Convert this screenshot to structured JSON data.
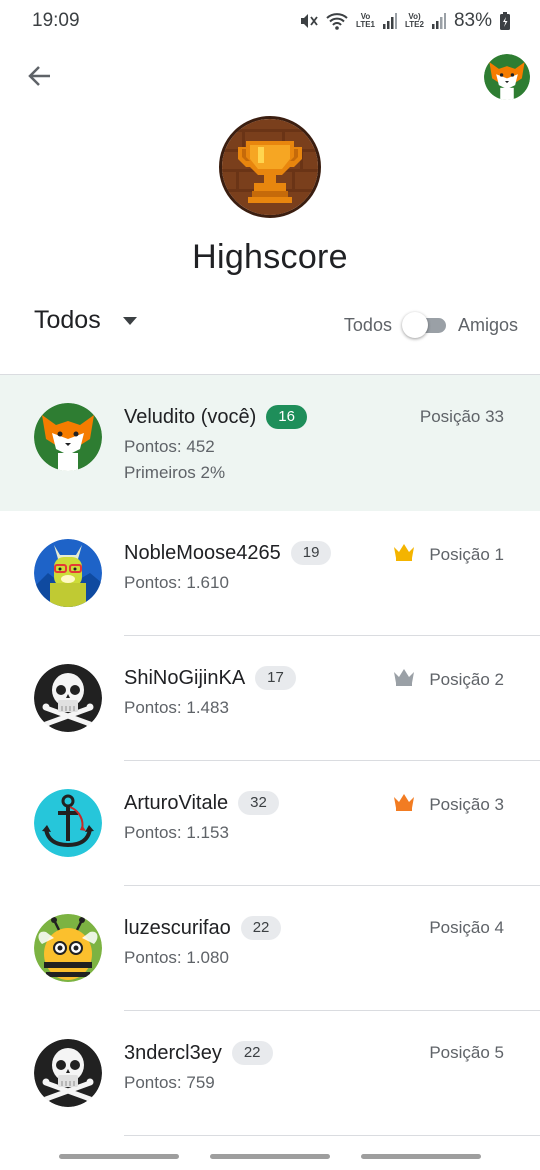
{
  "status_bar": {
    "time": "19:09",
    "battery": "83%",
    "icons": [
      "mute-icon",
      "wifi-icon",
      "volte-lte1-icon",
      "signal-1-icon",
      "volte-lte2-icon",
      "signal-2-icon",
      "battery-charging-icon"
    ],
    "lte1_top": "Vo",
    "lte1_bottom": "LTE1",
    "lte2_top": "Vo)",
    "lte2_bottom": "LTE2"
  },
  "header": {
    "title": "Highscore",
    "back_icon": "arrow-back-icon",
    "trophy_icon": "pixel-trophy-icon"
  },
  "filters": {
    "dropdown_value": "Todos",
    "toggle_left": "Todos",
    "toggle_right": "Amigos",
    "toggle_on": false
  },
  "leaderboard": [
    {
      "name": "Veludito (você)",
      "level": "16",
      "points": "Pontos: 452",
      "percentile": "Primeiros 2%",
      "rank": "Posição 33",
      "avatar": "fox-avatar",
      "crown": null,
      "is_me": true
    },
    {
      "name": "NobleMoose4265",
      "level": "19",
      "points": "Pontos: 1.610",
      "rank": "Posição 1",
      "avatar": "llama-avatar",
      "crown": "#f4b400"
    },
    {
      "name": "ShiNoGijinKA",
      "level": "17",
      "points": "Pontos: 1.483",
      "rank": "Posição 2",
      "avatar": "skull-avatar",
      "crown": "#9aa0a6"
    },
    {
      "name": "ArturoVitale",
      "level": "32",
      "points": "Pontos: 1.153",
      "rank": "Posição 3",
      "avatar": "anchor-avatar",
      "crown": "#f27c22"
    },
    {
      "name": "luzescurifao",
      "level": "22",
      "points": "Pontos: 1.080",
      "rank": "Posição 4",
      "avatar": "bee-avatar",
      "crown": null
    },
    {
      "name": "3ndercl3ey",
      "level": "22",
      "points": "Pontos: 759",
      "rank": "Posição 5",
      "avatar": "skull-avatar",
      "crown": null
    }
  ],
  "colors": {
    "me_background": "#eef5f2",
    "me_badge": "#1e8e5a",
    "gold": "#f4b400",
    "silver": "#9aa0a6",
    "bronze": "#f27c22"
  }
}
